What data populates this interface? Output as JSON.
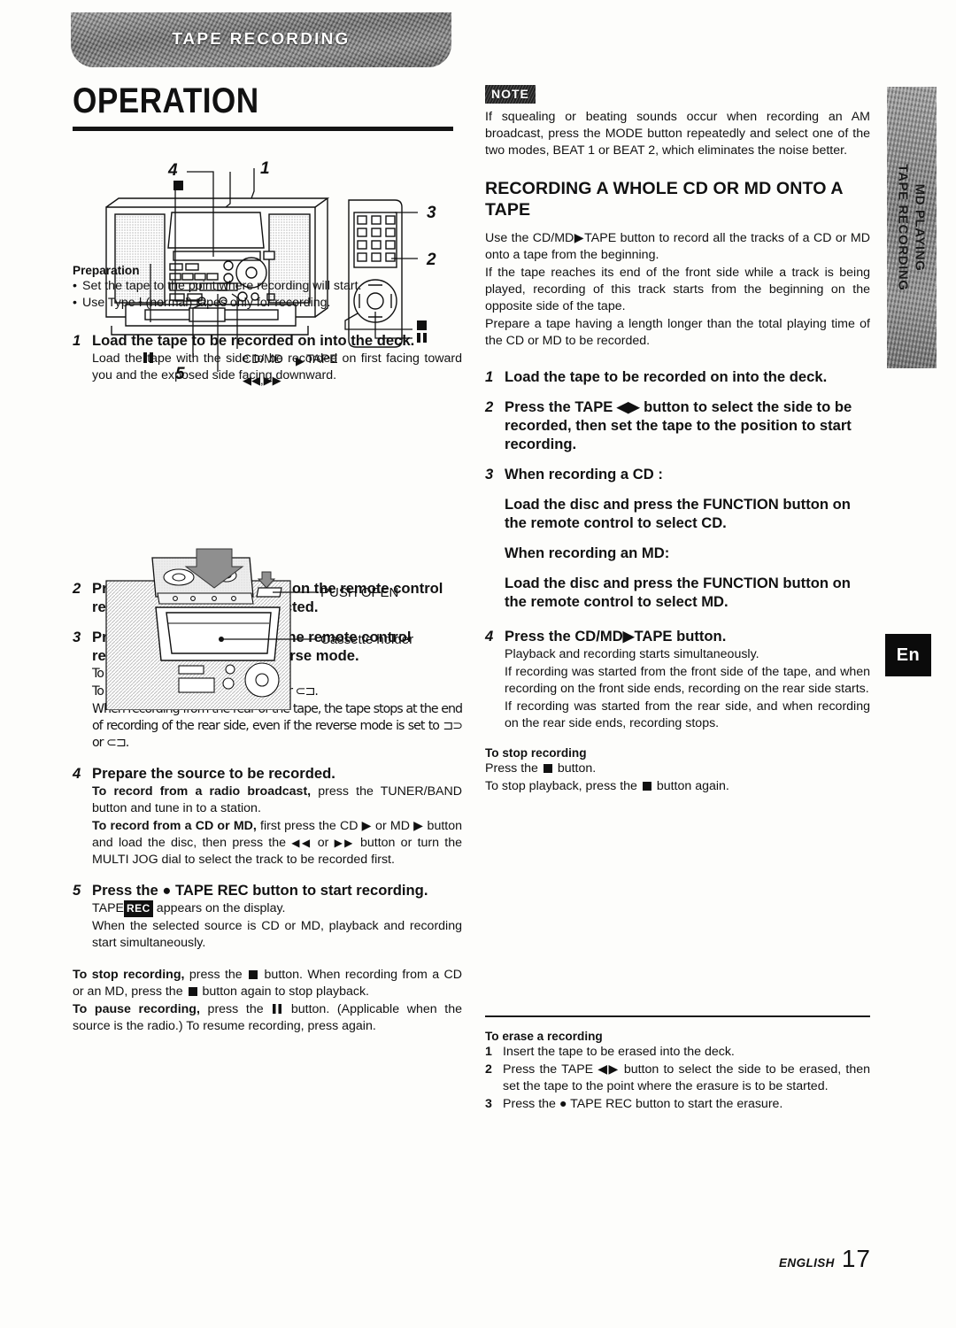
{
  "banner": {
    "label": "TAPE RECORDING"
  },
  "page_title": "OPERATION",
  "side_tab": {
    "line1": "MD PLAYING",
    "line2": "TAPE RECORDING"
  },
  "lang_badge": "En",
  "footer": {
    "language": "ENGLISH",
    "page_number": "17"
  },
  "diagram_main": {
    "callouts": [
      "4",
      "1",
      "3",
      "2",
      "5"
    ],
    "labels": {
      "cd_md_tape": "CD/MD▶TAPE",
      "skip": "◀◀,▶▶"
    }
  },
  "diagram_cassette": {
    "label_push_open": "PUSH OPEN",
    "label_cassette_holder": "Cassette holder"
  },
  "left_column": {
    "preparation": {
      "heading": "Preparation",
      "bullets": [
        "Set the tape to the point where recording will start.",
        "Use Type Ɨ (normal) tapes only for recording."
      ]
    },
    "steps": [
      {
        "num": "1",
        "heading": "Load the tape to be recorded on into the deck.",
        "body": [
          "Load the tape with the side to be recorded on first facing toward you and the exposed side facing downward."
        ]
      },
      {
        "num": "2",
        "heading": "Press the FUNCTION button on the remote control repeatedly until tape is selected.",
        "body": []
      },
      {
        "num": "3",
        "heading": "Press the MODE button on the remote control repeatedly to select the reverse mode.",
        "body": [
          "To record on one side only, select ⊐.",
          "To record on both sides, select ⊐⊃ or ⊂⊐.",
          "When recording from the rear of the tape, the tape stops at the end of recording of the rear side, even if the reverse mode is set to ⊐⊃ or ⊂⊐."
        ]
      },
      {
        "num": "4",
        "heading": "Prepare the source to be recorded.",
        "body": []
      },
      {
        "num": "5",
        "heading": "Press the ● TAPE REC button to start recording.",
        "body": []
      }
    ],
    "step4_detail": {
      "radio_bold": "To record from a radio broadcast,",
      "radio_rest": " press the TUNER/BAND button and tune in to a station.",
      "cdmd_bold": "To record from a CD or MD,",
      "cdmd_rest_1": " first press the CD ▶ or MD ▶ button and load the disc, then press the ",
      "cdmd_rest_2": " or ",
      "cdmd_rest_3": " button or turn the MULTI JOG dial to select the track to be recorded first."
    },
    "step5_detail": {
      "line1_pre": "TAPE",
      "line1_rec": "REC",
      "line1_post": " appears on the display.",
      "line2": "When the selected source is CD or MD, playback and recording start simultaneously."
    },
    "stop_pause": {
      "stop_bold": "To stop recording,",
      "stop_rest_1": " press the ",
      "stop_rest_2": " button. When recording from a CD or an MD, press the ",
      "stop_rest_3": " button again to stop playback.",
      "pause_bold": "To pause recording,",
      "pause_rest_1": " press the ",
      "pause_rest_2": " button. (Applicable when the source is the radio.)  To resume recording, press again."
    }
  },
  "right_column": {
    "note": {
      "badge": "NOTE",
      "text": "If squealing or beating sounds occur when recording an AM broadcast, press the MODE button repeatedly and select one of the two modes, BEAT 1 or BEAT 2,  which eliminates the noise better."
    },
    "section_title": "RECORDING A WHOLE CD OR MD ONTO A TAPE",
    "intro": [
      "Use the CD/MD▶TAPE button to record all the tracks of a CD or MD onto a tape from the beginning.",
      "If the tape reaches its end of the front side while a track is being played, recording of this track starts from the beginning on the opposite side of the tape.",
      "Prepare a tape having a length longer than the total playing time of the CD or MD to be recorded."
    ],
    "steps": [
      {
        "num": "1",
        "heading": "Load the tape to be recorded on into the deck.",
        "body": []
      },
      {
        "num": "2",
        "heading": "Press the TAPE ◀▶ button to select the side to be recorded, then set the tape to the position to start recording.",
        "body": []
      },
      {
        "num": "3",
        "heading": "When recording a CD :",
        "sub_headings": [
          "Load the disc and press the FUNCTION button on the remote control to select CD.",
          "When recording an MD:",
          "Load the disc and press the FUNCTION button on the remote control to select MD."
        ],
        "body": []
      },
      {
        "num": "4",
        "heading": "Press the CD/MD▶TAPE button.",
        "body": [
          "Playback and recording starts simultaneously.",
          "If recording was started from the front side of the tape, and when recording on the front side ends, recording on the rear side starts.",
          "If recording was started from the rear side, and when recording on the rear side ends, recording stops."
        ]
      }
    ],
    "stop_recording": {
      "heading": "To stop recording",
      "line1_pre": "Press the ",
      "line1_post": " button.",
      "line2_pre": "To stop playback, press the ",
      "line2_post": " button again."
    },
    "erase": {
      "heading": "To erase a recording",
      "items": [
        {
          "num": "1",
          "text": "Insert the tape to be erased into the deck."
        },
        {
          "num": "2",
          "text": "Press the TAPE ◀▶ button to select the side to be erased, then set the tape to the point where the erasure is to be started."
        },
        {
          "num": "3",
          "text": "Press the ● TAPE REC button to start the erasure."
        }
      ]
    }
  }
}
